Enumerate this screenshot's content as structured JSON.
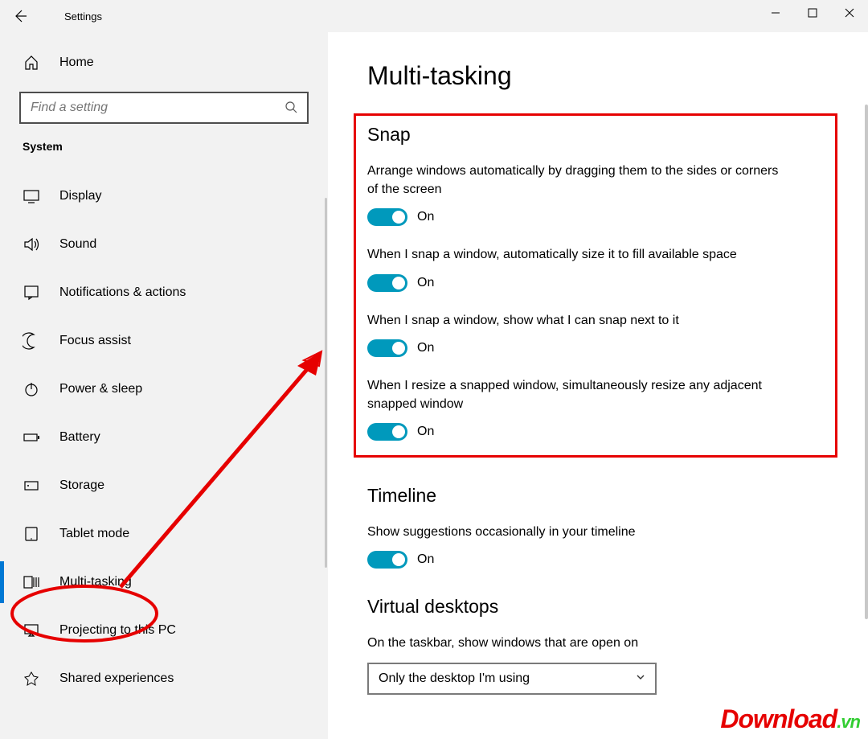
{
  "window": {
    "title": "Settings"
  },
  "sidebar": {
    "home": "Home",
    "search_placeholder": "Find a setting",
    "category": "System",
    "items": [
      {
        "label": "Display"
      },
      {
        "label": "Sound"
      },
      {
        "label": "Notifications & actions"
      },
      {
        "label": "Focus assist"
      },
      {
        "label": "Power & sleep"
      },
      {
        "label": "Battery"
      },
      {
        "label": "Storage"
      },
      {
        "label": "Tablet mode"
      },
      {
        "label": "Multi-tasking"
      },
      {
        "label": "Projecting to this PC"
      },
      {
        "label": "Shared experiences"
      }
    ],
    "active_index": 8
  },
  "page": {
    "title": "Multi-tasking",
    "snap": {
      "heading": "Snap",
      "settings": [
        {
          "desc": "Arrange windows automatically by dragging them to the sides or corners of the screen",
          "state": "On",
          "on": true
        },
        {
          "desc": "When I snap a window, automatically size it to fill available space",
          "state": "On",
          "on": true
        },
        {
          "desc": "When I snap a window, show what I can snap next to it",
          "state": "On",
          "on": true
        },
        {
          "desc": "When I resize a snapped window, simultaneously resize any adjacent snapped window",
          "state": "On",
          "on": true
        }
      ]
    },
    "timeline": {
      "heading": "Timeline",
      "setting": {
        "desc": "Show suggestions occasionally in your timeline",
        "state": "On",
        "on": true
      }
    },
    "virtual_desktops": {
      "heading": "Virtual desktops",
      "label": "On the taskbar, show windows that are open on",
      "selected": "Only the desktop I'm using"
    }
  },
  "colors": {
    "accent": "#0078d4",
    "toggle": "#0099bc",
    "annotation": "#e60000"
  },
  "watermark": {
    "main": "Download",
    "suffix": ".vn"
  }
}
